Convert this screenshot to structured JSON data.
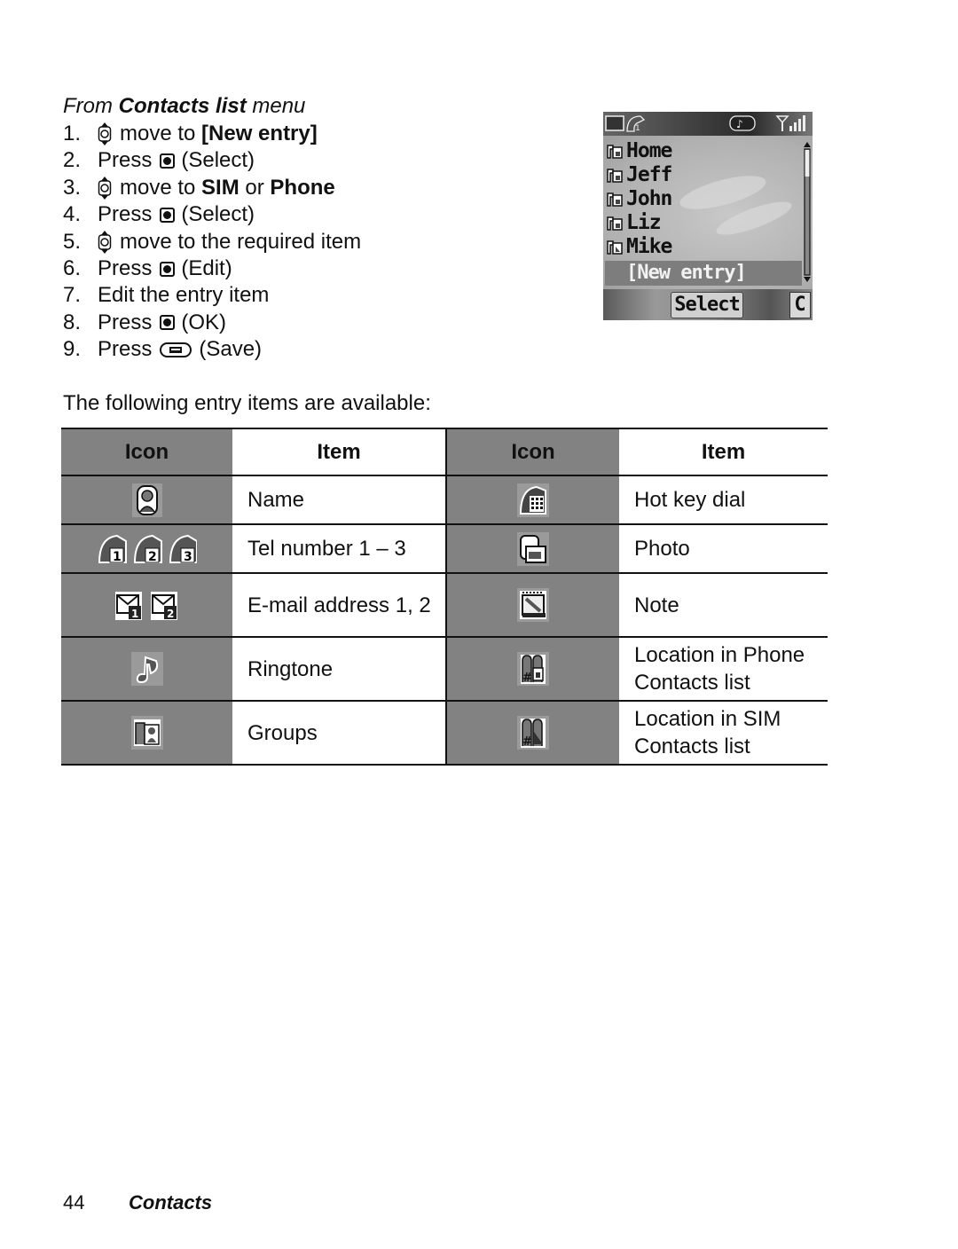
{
  "section": {
    "heading_prefix": "From ",
    "heading_bold": "Contacts list",
    "heading_suffix": " menu"
  },
  "steps": [
    {
      "num": "1.",
      "icon": "navigation-key-icon",
      "text": "move to ",
      "bold": "[New entry]"
    },
    {
      "num": "2.",
      "pre": "Press",
      "icon": "select-key-icon",
      "text": "(Select)"
    },
    {
      "num": "3.",
      "icon": "navigation-key-icon",
      "text": "move to ",
      "bold": "SIM",
      "mid": " or ",
      "bold2": "Phone"
    },
    {
      "num": "4.",
      "pre": "Press",
      "icon": "select-key-icon",
      "text": "(Select)"
    },
    {
      "num": "5.",
      "icon": "navigation-key-icon",
      "text": "move to the required item"
    },
    {
      "num": "6.",
      "pre": "Press",
      "icon": "select-key-icon",
      "text": "(Edit)"
    },
    {
      "num": "7.",
      "text": "Edit the entry item"
    },
    {
      "num": "8.",
      "pre": "Press",
      "icon": "select-key-icon",
      "text": "(OK)"
    },
    {
      "num": "9.",
      "pre": "Press",
      "icon": "soft-key-icon",
      "text": "(Save)"
    }
  ],
  "intro": "The following entry items are available:",
  "phone_screen": {
    "status_icons": [
      "battery-icon",
      "line-1-icon",
      "ringer-icon",
      "signal-strength-icon"
    ],
    "contacts": [
      "Home",
      "Jeff",
      "John",
      "Liz",
      "Mike"
    ],
    "selected": "[New entry]",
    "softkey_center": "Select",
    "softkey_right": "C"
  },
  "table": {
    "headers": [
      "Icon",
      "Item",
      "Icon",
      "Item"
    ],
    "rows": [
      {
        "icon_left": "name-icon",
        "item_left": "Name",
        "icon_right": "hot-key-dial-icon",
        "item_right": "Hot key dial"
      },
      {
        "icon_left": "tel-number-icons",
        "item_left": "Tel number 1 – 3",
        "icon_right": "photo-icon",
        "item_right": "Photo"
      },
      {
        "icon_left": "email-address-icons",
        "item_left": "E-mail address 1, 2",
        "icon_right": "note-icon",
        "item_right": "Note"
      },
      {
        "icon_left": "ringtone-icon",
        "item_left": "Ringtone",
        "icon_right": "location-phone-icon",
        "item_right": "Location in Phone Contacts list"
      },
      {
        "icon_left": "groups-icon",
        "item_left": "Groups",
        "icon_right": "location-sim-icon",
        "item_right": "Location in SIM Contacts list"
      }
    ]
  },
  "footer": {
    "page_number": "44",
    "section_title": "Contacts"
  }
}
